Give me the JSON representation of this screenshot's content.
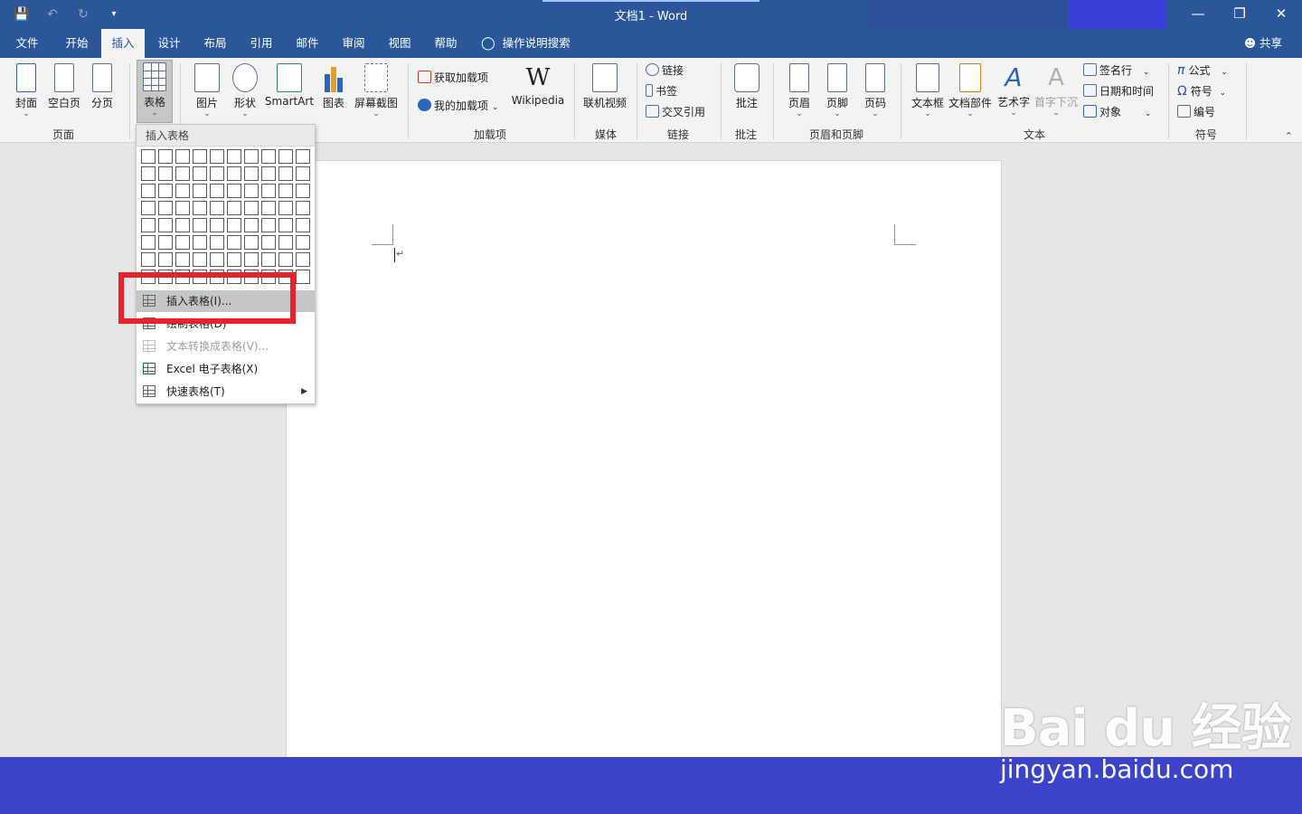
{
  "titlebar": {
    "title": "文档1  -  Word",
    "qat": [
      "save-icon",
      "undo-icon",
      "redo-icon",
      "customize-icon"
    ]
  },
  "tabs": [
    "文件",
    "开始",
    "插入",
    "设计",
    "布局",
    "引用",
    "邮件",
    "审阅",
    "视图",
    "帮助"
  ],
  "active_tab": "插入",
  "tellme": "操作说明搜索",
  "share": "共享",
  "ribbon": {
    "pages": {
      "label": "页面",
      "cover": "封面",
      "blank": "空白页",
      "break": "分页"
    },
    "tables": {
      "table": "表格"
    },
    "illustrations": {
      "picture": "图片",
      "shapes": "形状",
      "smartart": "SmartArt",
      "chart": "图表",
      "screenshot": "屏幕截图"
    },
    "addins": {
      "label": "加载项",
      "get": "获取加载项",
      "my": "我的加载项",
      "wikipedia": "Wikipedia"
    },
    "media": {
      "label": "媒体",
      "online_video": "联机视频"
    },
    "links": {
      "label": "链接",
      "link": "链接",
      "bookmark": "书签",
      "crossref": "交叉引用"
    },
    "comments": {
      "label": "批注",
      "comment": "批注"
    },
    "headerfooter": {
      "label": "页眉和页脚",
      "header": "页眉",
      "footer": "页脚",
      "pagenum": "页码"
    },
    "text": {
      "label": "文本",
      "textbox": "文本框",
      "quickparts": "文档部件",
      "wordart": "艺术字",
      "dropcap": "首字下沉",
      "signature": "签名行",
      "datetime": "日期和时间",
      "object": "对象"
    },
    "symbols": {
      "label": "符号",
      "equation": "公式",
      "symbol": "符号",
      "number": "编号"
    }
  },
  "dropdown": {
    "header": "插入表格",
    "grid_cols": 10,
    "grid_rows": 8,
    "items": [
      {
        "label": "插入表格(I)...",
        "state": "highlighted"
      },
      {
        "label": "绘制表格(D)",
        "state": "normal"
      },
      {
        "label": "文本转换成表格(V)...",
        "state": "disabled"
      },
      {
        "label": "Excel 电子表格(X)",
        "state": "normal"
      },
      {
        "label": "快速表格(T)",
        "state": "submenu"
      }
    ]
  },
  "watermark": {
    "logo": "Bai du 经验",
    "url": "jingyan.baidu.com"
  },
  "colors": {
    "ribbon_blue": "#2b579a",
    "highlight_red": "#e8222a",
    "footer_band": "#3d43c8"
  }
}
